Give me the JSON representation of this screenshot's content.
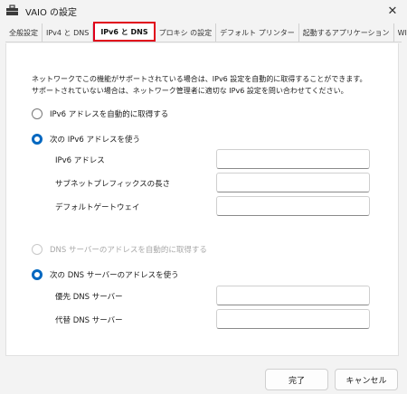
{
  "window": {
    "title": "VAIO の設定",
    "close_icon": "close-icon"
  },
  "tabs": [
    {
      "label": "全般設定",
      "active": false
    },
    {
      "label": "IPv4 と DNS",
      "active": false
    },
    {
      "label": "IPv6 と DNS",
      "active": true
    },
    {
      "label": "プロキシ の設定",
      "active": false
    },
    {
      "label": "デフォルト プリンター",
      "active": false
    },
    {
      "label": "起動するアプリケーション",
      "active": false
    },
    {
      "label": "WINS",
      "active": false
    }
  ],
  "description": {
    "line1": "ネットワークでこの機能がサポートされている場合は、IPv6 設定を自動的に取得することができます。",
    "line2": "サポートされていない場合は、ネットワーク管理者に適切な IPv6 設定を問い合わせてください。"
  },
  "ip": {
    "auto_label": "IPv6 アドレスを自動的に取得する",
    "manual_label": "次の IPv6 アドレスを使う",
    "selected": "manual",
    "fields": [
      {
        "label": "IPv6 アドレス",
        "value": ""
      },
      {
        "label": "サブネットプレフィックスの長さ",
        "value": ""
      },
      {
        "label": "デフォルトゲートウェイ",
        "value": ""
      }
    ]
  },
  "dns": {
    "auto_label": "DNS サーバーのアドレスを自動的に取得する",
    "auto_disabled": true,
    "manual_label": "次の DNS サーバーのアドレスを使う",
    "selected": "manual",
    "fields": [
      {
        "label": "優先 DNS サーバー",
        "value": ""
      },
      {
        "label": "代替 DNS サーバー",
        "value": ""
      }
    ]
  },
  "buttons": {
    "ok": "完了",
    "cancel": "キャンセル"
  },
  "colors": {
    "accent": "#0067c0",
    "highlight": "#e0001a"
  }
}
